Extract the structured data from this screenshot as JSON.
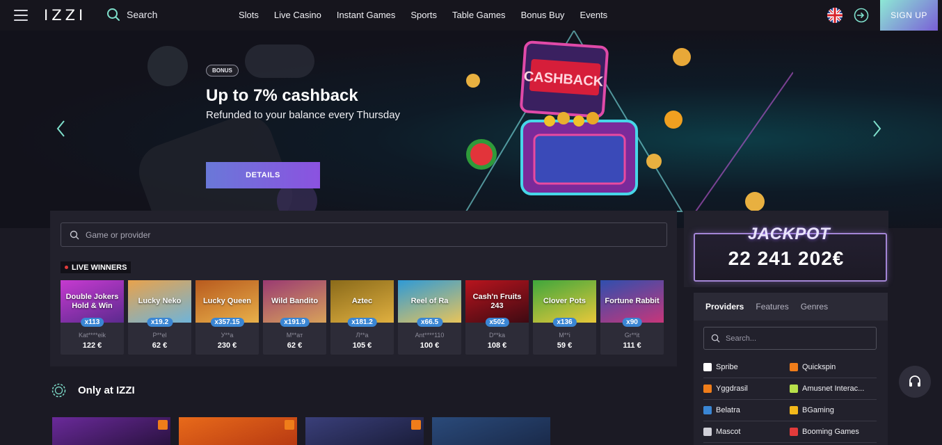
{
  "header": {
    "logo": "IZZI",
    "search_label": "Search",
    "nav": [
      "Slots",
      "Live Casino",
      "Instant Games",
      "Sports",
      "Table Games",
      "Bonus Buy",
      "Events"
    ],
    "signup_label": "SIGN UP"
  },
  "hero": {
    "badge": "BONUS",
    "title": "Up to 7% cashback",
    "subtitle": "Refunded to your balance every Thursday",
    "cta": "DETAILS",
    "chest_text": "CASHBACK"
  },
  "game_search": {
    "placeholder": "Game or provider"
  },
  "live_winners": {
    "label": "LIVE WINNERS",
    "items": [
      {
        "game": "Double Jokers Hold & Win",
        "mult": "x113",
        "name": "Kat****eik",
        "amount": "122 €",
        "color1": "#c63ad0",
        "color2": "#5b2a8e"
      },
      {
        "game": "Lucky Neko",
        "mult": "x19.2",
        "name": "P**el",
        "amount": "62 €",
        "color1": "#e8a24c",
        "color2": "#6fb4d9"
      },
      {
        "game": "Lucky Queen",
        "mult": "x357.15",
        "name": "У**а",
        "amount": "230 €",
        "color1": "#b85a1e",
        "color2": "#e8b04a"
      },
      {
        "game": "Wild Bandito",
        "mult": "x191.9",
        "name": "М**ат",
        "amount": "62 €",
        "color1": "#9a3a72",
        "color2": "#d8a25a"
      },
      {
        "game": "Aztec",
        "mult": "x181.2",
        "name": "Л**а",
        "amount": "105 €",
        "color1": "#8a6a1a",
        "color2": "#e0b040"
      },
      {
        "game": "Reel of Ra",
        "mult": "x66.5",
        "name": "Ant****110",
        "amount": "100 €",
        "color1": "#2f9ad6",
        "color2": "#e8c45a"
      },
      {
        "game": "Cash'n Fruits 243",
        "mult": "x502",
        "name": "D**ka",
        "amount": "108 €",
        "color1": "#b8141e",
        "color2": "#3e0a12"
      },
      {
        "game": "Clover Pots",
        "mult": "x136",
        "name": "М**і",
        "amount": "59 €",
        "color1": "#3fa63c",
        "color2": "#e8c83a"
      },
      {
        "game": "Fortune Rabbit",
        "mult": "x90",
        "name": "Gr**it",
        "amount": "111 €",
        "color1": "#2f4fae",
        "color2": "#c8367a"
      }
    ]
  },
  "only_at": {
    "title": "Only at IZZI",
    "cards": [
      {
        "color1": "#6a2a9a",
        "color2": "#2a1240"
      },
      {
        "color1": "#e86a1a",
        "color2": "#b83a12"
      },
      {
        "color1": "#3a3f7a",
        "color2": "#1a1d3a"
      },
      {
        "color1": "#2a4a7a",
        "color2": "#1a2a4a"
      }
    ]
  },
  "jackpot": {
    "title": "JACKPOT",
    "amount": "22 241 202€"
  },
  "providers_panel": {
    "tabs": [
      "Providers",
      "Features",
      "Genres"
    ],
    "search_placeholder": "Search...",
    "rows": [
      [
        {
          "name": "Spribe",
          "icon_color": "#ffffff"
        },
        {
          "name": "Quickspin",
          "icon_color": "#ef7d1a"
        }
      ],
      [
        {
          "name": "Yggdrasil",
          "icon_color": "#ef7d1a"
        },
        {
          "name": "Amusnet Interac...",
          "icon_color": "#b7e04a"
        }
      ],
      [
        {
          "name": "Belatra",
          "icon_color": "#3a86d4"
        },
        {
          "name": "BGaming",
          "icon_color": "#f2b81a"
        }
      ],
      [
        {
          "name": "Mascot",
          "icon_color": "#d0d0d8"
        },
        {
          "name": "Booming Games",
          "icon_color": "#e23b3b"
        }
      ]
    ]
  }
}
